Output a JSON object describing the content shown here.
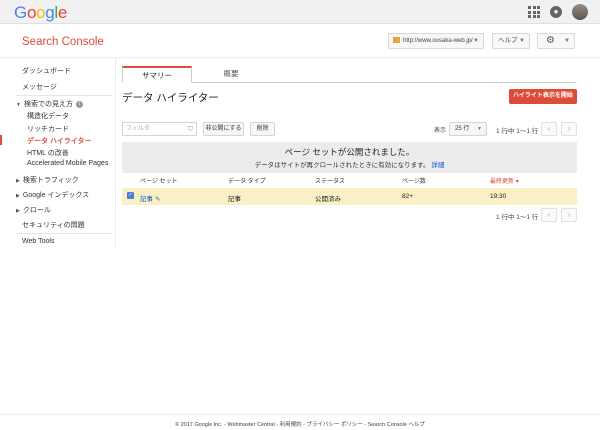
{
  "brand": {
    "logo_letters": [
      "G",
      "o",
      "o",
      "g",
      "l",
      "e"
    ],
    "logo_colors": [
      "#4285F4",
      "#EA4335",
      "#FBBC05",
      "#4285F4",
      "#34A853",
      "#EA4335"
    ],
    "accent_color": "#dd4b39"
  },
  "topbar": {
    "apps_icon": "apps-grid-icon",
    "notifications_icon": "notifications-icon",
    "avatar_icon": "account-avatar"
  },
  "header": {
    "product_title": "Search Console",
    "site_url": "http://www.oosaka-web.jp/",
    "help_label": "ヘルプ",
    "settings_icon": "gear-icon"
  },
  "sidebar": {
    "dashboard": "ダッシュボード",
    "messages": "メッセージ",
    "search_appearance": "検索での見え方",
    "search_appearance_info": "i",
    "structured_data": "構造化データ",
    "rich_cards": "リッチカード",
    "data_highlighter": "データ ハイライター",
    "html_improvements": "HTML の改善",
    "amp": "Accelerated Mobile Pages",
    "search_traffic": "検索トラフィック",
    "google_index": "Google インデックス",
    "crawl": "クロール",
    "security_issues": "セキュリティの問題",
    "web_tools": "Web Tools"
  },
  "tabs": {
    "summary": "サマリー",
    "overview": "概要"
  },
  "main": {
    "title": "データ ハイライター",
    "start_highlight_button": "ハイライト表示を開始",
    "filter_placeholder": "フィルタ",
    "unpublish_button": "非公開にする",
    "delete_button": "削除",
    "show_label": "表示",
    "rows_per_page": "25 行",
    "range_text": "1 行中 1〜1 行",
    "prev_icon": "‹",
    "next_icon": "›"
  },
  "notice": {
    "title": "ページ セットが公開されました。",
    "body": "データはサイトが再クロールされたときに有効になります。",
    "link": "詳細"
  },
  "table": {
    "headers": {
      "page_set": "ページ セット",
      "data_type": "データ タイプ",
      "status": "ステータス",
      "page_count": "ページ数",
      "last_updated": "最終更新"
    },
    "sort_indicator": "▾",
    "rows": [
      {
        "page_set": "記事",
        "data_type": "記事",
        "status": "公開済み",
        "page_count": "82+",
        "last_updated": "19:30",
        "selected": true
      }
    ]
  },
  "footer": {
    "text": "© 2017 Google Inc. - Webmaster Central - 利用規約 - プライバシー ポリシー - Search Console ヘルプ"
  }
}
